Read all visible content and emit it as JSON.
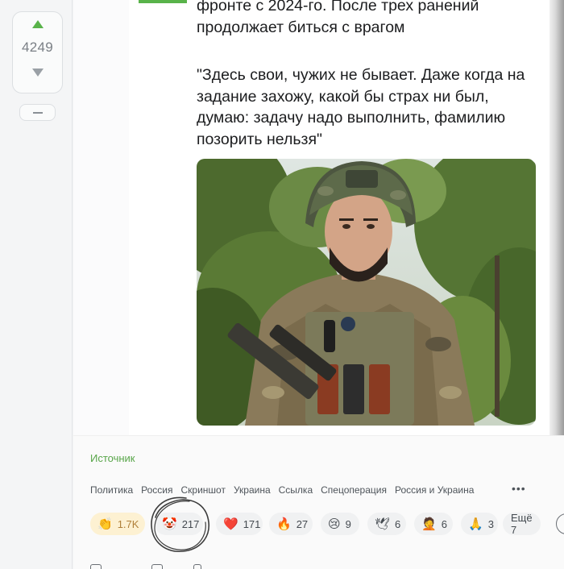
{
  "vote": {
    "count": "4249"
  },
  "post": {
    "lines_top": [
      "фронте с 2024-го. После трех ранений",
      "продолжает биться с врагом"
    ],
    "quote": "\"Здесь свои, чужих не бывает. Даже когда на задание захожу, какой бы страх ни был, думаю: задачу надо выполнить, фамилию позорить нельзя\""
  },
  "footer": {
    "source_label": "Источник",
    "tags": [
      "Политика",
      "Россия",
      "Скриншот",
      "Украина",
      "Ссылка",
      "Спецоперация",
      "Россия и Украина"
    ],
    "more_tags_label": "•••",
    "reactions": [
      {
        "icon": "clap-hands-icon",
        "emoji": "👏",
        "count": "1.7K"
      },
      {
        "icon": "clown-face-icon",
        "emoji": "🤡",
        "count": "217"
      },
      {
        "icon": "heart-icon",
        "emoji": "❤️",
        "count": "171"
      },
      {
        "icon": "fire-icon",
        "emoji": "🔥",
        "count": "27"
      },
      {
        "icon": "crying-face-icon",
        "emoji": "😢",
        "count": "9"
      },
      {
        "icon": "dove-icon",
        "emoji": "🕊",
        "count": "6"
      },
      {
        "icon": "facepalm-icon",
        "emoji": "🤦",
        "count": "6"
      },
      {
        "icon": "pray-hands-icon",
        "emoji": "🙏",
        "count": "3"
      }
    ],
    "more_reactions_label": "Ещё 7"
  },
  "colors": {
    "accent": "#59b34a",
    "link": "#59a64a"
  }
}
